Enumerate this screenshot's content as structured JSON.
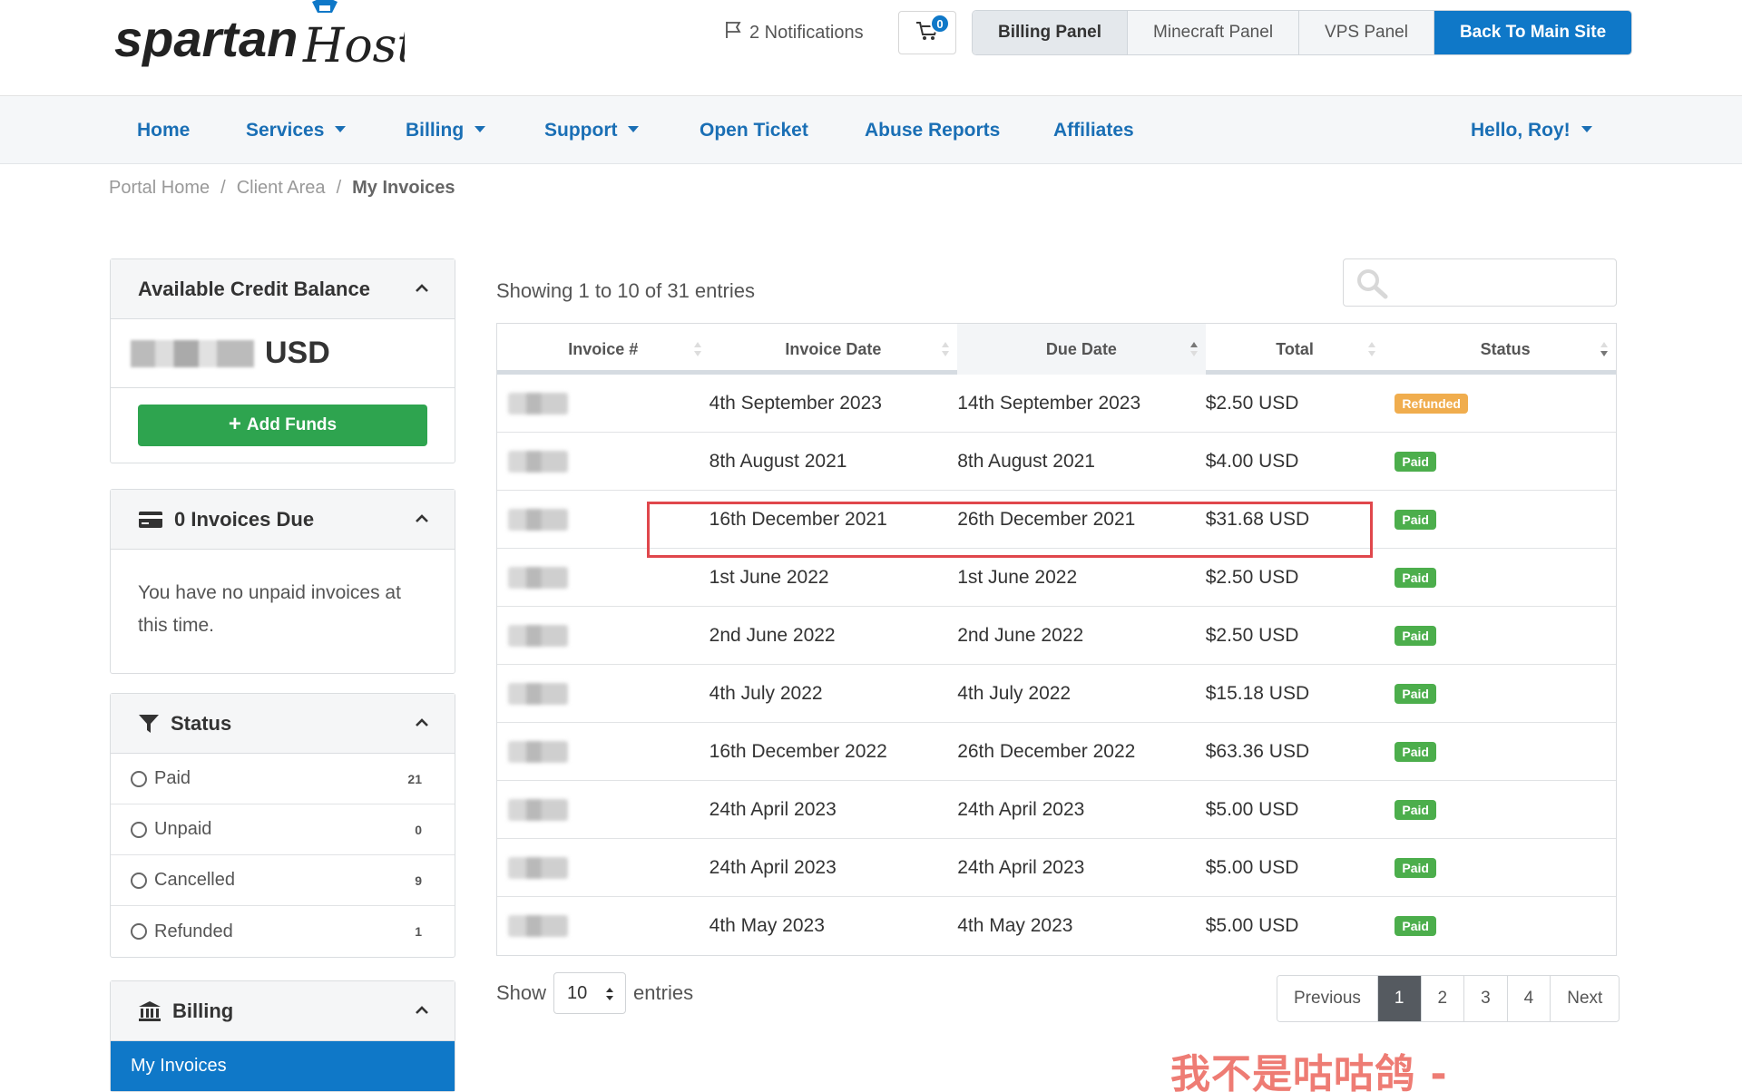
{
  "header": {
    "logo_word": "spartan",
    "logo_word2": "Host",
    "notifications_label": "2 Notifications",
    "cart_count": "0",
    "panels": [
      "Billing Panel",
      "Minecraft Panel",
      "VPS Panel"
    ],
    "back_label": "Back To Main Site"
  },
  "nav": {
    "items": [
      "Home",
      "Services",
      "Billing",
      "Support",
      "Open Ticket",
      "Abuse Reports",
      "Affiliates"
    ],
    "user": "Hello, Roy!"
  },
  "breadcrumb": [
    "Portal Home",
    "Client Area",
    "My Invoices"
  ],
  "sidebar": {
    "credit_title": "Available Credit Balance",
    "credit_suffix": "USD",
    "add_funds": "Add Funds",
    "invoices_due_title": "0 Invoices Due",
    "no_invoices_text": "You have no unpaid invoices at this time.",
    "status_title": "Status",
    "status_items": [
      {
        "label": "Paid",
        "count": "21"
      },
      {
        "label": "Unpaid",
        "count": "0"
      },
      {
        "label": "Cancelled",
        "count": "9"
      },
      {
        "label": "Refunded",
        "count": "1"
      }
    ],
    "billing_title": "Billing",
    "billing_active": "My Invoices"
  },
  "table": {
    "showing": "Showing 1 to 10 of 31 entries",
    "headers": [
      "Invoice #",
      "Invoice Date",
      "Due Date",
      "Total",
      "Status"
    ],
    "rows": [
      {
        "invoice_date": "4th September 2023",
        "due_date": "14th September 2023",
        "total": "$2.50 USD",
        "status": "Refunded"
      },
      {
        "invoice_date": "8th August 2021",
        "due_date": "8th August 2021",
        "total": "$4.00 USD",
        "status": "Paid"
      },
      {
        "invoice_date": "16th December 2021",
        "due_date": "26th December 2021",
        "total": "$31.68 USD",
        "status": "Paid"
      },
      {
        "invoice_date": "1st June 2022",
        "due_date": "1st June 2022",
        "total": "$2.50 USD",
        "status": "Paid"
      },
      {
        "invoice_date": "2nd June 2022",
        "due_date": "2nd June 2022",
        "total": "$2.50 USD",
        "status": "Paid"
      },
      {
        "invoice_date": "4th July 2022",
        "due_date": "4th July 2022",
        "total": "$15.18 USD",
        "status": "Paid"
      },
      {
        "invoice_date": "16th December 2022",
        "due_date": "26th December 2022",
        "total": "$63.36 USD",
        "status": "Paid"
      },
      {
        "invoice_date": "24th April 2023",
        "due_date": "24th April 2023",
        "total": "$5.00 USD",
        "status": "Paid"
      },
      {
        "invoice_date": "24th April 2023",
        "due_date": "24th April 2023",
        "total": "$5.00 USD",
        "status": "Paid"
      },
      {
        "invoice_date": "4th May 2023",
        "due_date": "4th May 2023",
        "total": "$5.00 USD",
        "status": "Paid"
      }
    ]
  },
  "footer": {
    "show_label": "Show",
    "entries_value": "10",
    "entries_label": "entries",
    "pagination": [
      "Previous",
      "1",
      "2",
      "3",
      "4",
      "Next"
    ],
    "active_page": "1"
  },
  "watermark": "我不是咕咕鸽 - blog.laoda.de",
  "colors": {
    "primary": "#0f78c8",
    "success": "#2ea44f",
    "paid": "#4cae4c",
    "refunded": "#f0ad4e",
    "highlight": "#e0474c"
  }
}
